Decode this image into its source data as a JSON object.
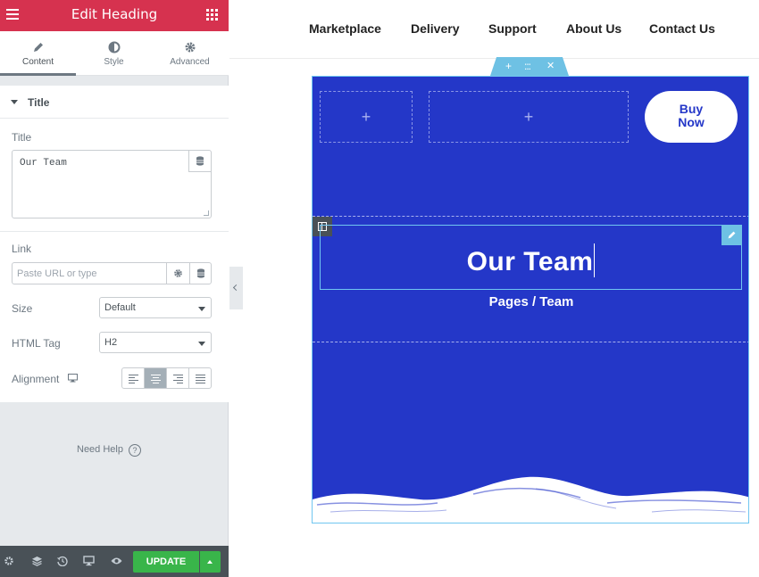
{
  "editor": {
    "title": "Edit Heading",
    "tabs": [
      {
        "label": "Content",
        "icon": "pencil-icon"
      },
      {
        "label": "Style",
        "icon": "half-circle-icon"
      },
      {
        "label": "Advanced",
        "icon": "gear-icon"
      }
    ],
    "section_title": "Title",
    "title_field": {
      "label": "Title",
      "value": "Our Team"
    },
    "link_field": {
      "label": "Link",
      "placeholder": "Paste URL or type"
    },
    "size_field": {
      "label": "Size",
      "value": "Default"
    },
    "html_tag_field": {
      "label": "HTML Tag",
      "value": "H2"
    },
    "alignment_field": {
      "label": "Alignment",
      "selected": "center"
    },
    "need_help": "Need Help",
    "help_glyph": "?",
    "update_label": "UPDATE",
    "accent_color": "#d6324f",
    "update_color": "#39b54a"
  },
  "site": {
    "nav": [
      "Marketplace",
      "Delivery",
      "Support",
      "About Us",
      "Contact Us"
    ],
    "cta_line1": "Buy",
    "cta_line2": "Now",
    "heading": "Our Team",
    "breadcrumb": "Pages / Team",
    "section_bg": "#2437c8",
    "handle_plus": "+",
    "handle_move": ":::",
    "handle_close": "✕",
    "column_plus": "+"
  }
}
